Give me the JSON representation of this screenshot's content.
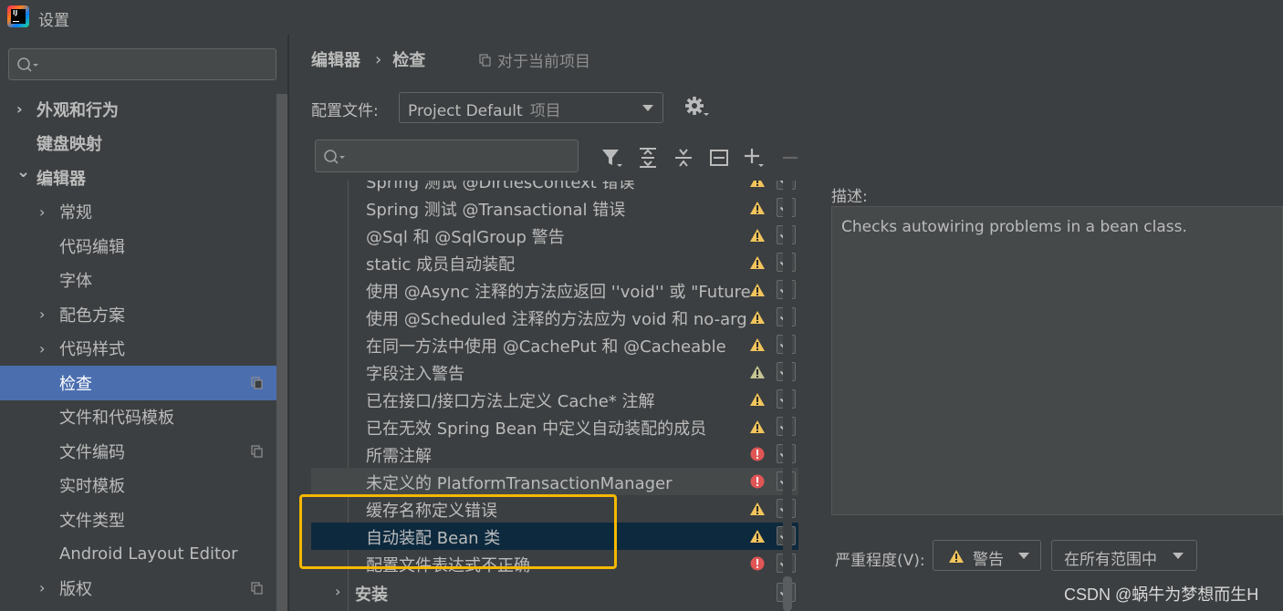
{
  "window": {
    "title": "设置"
  },
  "sidebar": {
    "search_placeholder": "",
    "items": [
      {
        "label": "外观和行为",
        "expandable": true,
        "expanded": false,
        "level": 0,
        "bold": true
      },
      {
        "label": "键盘映射",
        "expandable": false,
        "level": 0,
        "bold": true
      },
      {
        "label": "编辑器",
        "expandable": true,
        "expanded": true,
        "level": 0,
        "bold": true
      },
      {
        "label": "常规",
        "expandable": true,
        "expanded": false,
        "level": 1
      },
      {
        "label": "代码编辑",
        "expandable": false,
        "level": 1
      },
      {
        "label": "字体",
        "expandable": false,
        "level": 1
      },
      {
        "label": "配色方案",
        "expandable": true,
        "expanded": false,
        "level": 1
      },
      {
        "label": "代码样式",
        "expandable": true,
        "expanded": false,
        "level": 1
      },
      {
        "label": "检查",
        "expandable": false,
        "level": 1,
        "selected": true,
        "project_icon": true
      },
      {
        "label": "文件和代码模板",
        "expandable": false,
        "level": 1
      },
      {
        "label": "文件编码",
        "expandable": false,
        "level": 1,
        "project_icon": true
      },
      {
        "label": "实时模板",
        "expandable": false,
        "level": 1
      },
      {
        "label": "文件类型",
        "expandable": false,
        "level": 1
      },
      {
        "label": "Android Layout Editor",
        "expandable": false,
        "level": 1
      },
      {
        "label": "版权",
        "expandable": true,
        "expanded": false,
        "level": 1,
        "project_icon": true
      }
    ]
  },
  "header": {
    "breadcrumb": [
      "编辑器",
      "检查"
    ],
    "breadcrumb_sep": "›",
    "scope_hint": "对于当前项目"
  },
  "profile": {
    "label": "配置文件:",
    "value": "Project Default",
    "suffix": "项目"
  },
  "inspections": {
    "search_placeholder": "",
    "rows": [
      {
        "label": "Spring 测试 @DirtiesContext 错误",
        "severity": "warning",
        "checked": true
      },
      {
        "label": "Spring 测试 @Transactional 错误",
        "severity": "warning",
        "checked": true
      },
      {
        "label": "@Sql 和 @SqlGroup 警告",
        "severity": "warning",
        "checked": true
      },
      {
        "label": "static 成员自动装配",
        "severity": "warning",
        "checked": true
      },
      {
        "label": "使用 @Async 注释的方法应返回 ''void'' 或 \"Future",
        "severity": "warning",
        "checked": true
      },
      {
        "label": "使用 @Scheduled 注释的方法应为 void 和 no-arg",
        "severity": "warning",
        "checked": true
      },
      {
        "label": "在同一方法中使用 @CachePut 和 @Cacheable",
        "severity": "warning",
        "checked": true
      },
      {
        "label": "字段注入警告",
        "severity": "weak",
        "checked": true
      },
      {
        "label": "已在接口/接口方法上定义 Cache* 注解",
        "severity": "warning",
        "checked": true
      },
      {
        "label": "已在无效 Spring Bean 中定义自动装配的成员",
        "severity": "warning",
        "checked": true
      },
      {
        "label": "所需注解",
        "severity": "error",
        "checked": true
      },
      {
        "label": "未定义的 PlatformTransactionManager",
        "severity": "error",
        "checked": true,
        "hover": true
      },
      {
        "label": "缓存名称定义错误",
        "severity": "warning",
        "checked": true
      },
      {
        "label": "自动装配 Bean 类",
        "severity": "warning",
        "checked": true,
        "selected": true
      },
      {
        "label": "配置文件表达式不正确",
        "severity": "error",
        "checked": true
      }
    ],
    "group_row": {
      "label": "安装",
      "checked": true
    }
  },
  "description": {
    "label": "描述:",
    "text": "Checks autowiring problems in a bean class."
  },
  "severity": {
    "label": "严重程度(V):",
    "value": "警告",
    "scope": "在所有范围中"
  },
  "watermark": "CSDN @蜗牛为梦想而生H",
  "colors": {
    "background": "#3c3f41",
    "selection": "#4b6eaf",
    "row_selected": "#0d293e",
    "warning": "#f2c55c",
    "error": "#e05555",
    "highlight_box": "#f5b800"
  }
}
